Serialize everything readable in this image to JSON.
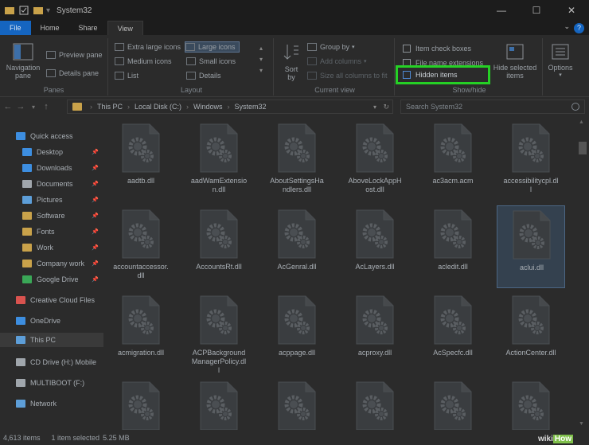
{
  "window": {
    "title": "System32"
  },
  "tabs": [
    "File",
    "Home",
    "Share",
    "View"
  ],
  "ribbon": {
    "panes": {
      "navigation_pane": "Navigation pane",
      "preview_pane": "Preview pane",
      "details_pane": "Details pane",
      "label": "Panes"
    },
    "layout": {
      "options": [
        "Extra large icons",
        "Large icons",
        "Medium icons",
        "Small icons",
        "List",
        "Details"
      ],
      "selected": "Large icons",
      "label": "Layout"
    },
    "current_view": {
      "sort_by": "Sort by",
      "group_by": "Group by",
      "add_columns": "Add columns",
      "size_columns": "Size all columns to fit",
      "label": "Current view"
    },
    "show_hide": {
      "item_check_boxes": "Item check boxes",
      "file_name_extensions": "File name extensions",
      "hidden_items": "Hidden items",
      "hide_selected": "Hide selected items",
      "label": "Show/hide"
    },
    "options": "Options"
  },
  "address": {
    "crumbs": [
      "This PC",
      "Local Disk (C:)",
      "Windows",
      "System32"
    ],
    "search_placeholder": "Search System32"
  },
  "nav": [
    {
      "label": "Quick access",
      "icon": "star-icon",
      "pinned": false
    },
    {
      "label": "Desktop",
      "icon": "desktop-icon",
      "pinned": true
    },
    {
      "label": "Downloads",
      "icon": "download-icon",
      "pinned": true
    },
    {
      "label": "Documents",
      "icon": "document-icon",
      "pinned": true
    },
    {
      "label": "Pictures",
      "icon": "picture-icon",
      "pinned": true
    },
    {
      "label": "Software",
      "icon": "folder-icon",
      "pinned": true
    },
    {
      "label": "Fonts",
      "icon": "folder-icon",
      "pinned": true
    },
    {
      "label": "Work",
      "icon": "folder-icon",
      "pinned": true
    },
    {
      "label": "Company work",
      "icon": "folder-icon",
      "pinned": true
    },
    {
      "label": "Google Drive",
      "icon": "google-drive-icon",
      "pinned": true
    },
    {
      "label": "Creative Cloud Files",
      "icon": "creative-cloud-icon",
      "pinned": false
    },
    {
      "label": "OneDrive",
      "icon": "cloud-icon",
      "pinned": false
    },
    {
      "label": "This PC",
      "icon": "computer-icon",
      "pinned": false
    },
    {
      "label": "CD Drive (H:) Mobile",
      "icon": "cd-drive-icon",
      "pinned": false
    },
    {
      "label": "MULTIBOOT (F:)",
      "icon": "usb-drive-icon",
      "pinned": false
    },
    {
      "label": "Network",
      "icon": "network-icon",
      "pinned": false
    }
  ],
  "files": [
    [
      "aadtb.dll"
    ],
    [
      "aadWamExtension.dll"
    ],
    [
      "AboutSettingsHandlers.dll"
    ],
    [
      "AboveLockAppHost.dll"
    ],
    [
      "ac3acm.acm"
    ],
    [
      "accessibilitycpl.dll"
    ],
    [
      "accountaccessor.dll"
    ],
    [
      "AccountsRt.dll"
    ],
    [
      "AcGenral.dll"
    ],
    [
      "AcLayers.dll"
    ],
    [
      "acledit.dll"
    ],
    [
      "aclui.dll"
    ],
    [
      "acmigration.dll"
    ],
    [
      "ACPBackgroundManagerPolicy.dll"
    ],
    [
      "acppage.dll"
    ],
    [
      "acproxy.dll"
    ],
    [
      "AcSpecfc.dll"
    ],
    [
      "ActionCenter.dll"
    ]
  ],
  "file_labels": [
    [
      "aadtb.dll"
    ],
    [
      "aadWamExtensio",
      "n.dll"
    ],
    [
      "AboutSettingsHa",
      "ndlers.dll"
    ],
    [
      "AboveLockAppH",
      "ost.dll"
    ],
    [
      "ac3acm.acm"
    ],
    [
      "accessibilitycpl.dl",
      "l"
    ],
    [
      "accountaccessor.",
      "dll"
    ],
    [
      "AccountsRt.dll"
    ],
    [
      "AcGenral.dll"
    ],
    [
      "AcLayers.dll"
    ],
    [
      "acledit.dll"
    ],
    [
      "aclui.dll"
    ],
    [
      "acmigration.dll"
    ],
    [
      "ACPBackground",
      "ManagerPolicy.dl",
      "l"
    ],
    [
      "acppage.dll"
    ],
    [
      "acproxy.dll"
    ],
    [
      "AcSpecfc.dll"
    ],
    [
      "ActionCenter.dll"
    ]
  ],
  "selected_file": "aclui.dll",
  "status": {
    "count": "4,613 items",
    "selection": "1 item selected",
    "size": "5.25 MB"
  },
  "watermark": "wikiHow",
  "colors": {
    "highlight": "#25d025",
    "file_tab": "#1565c0",
    "folder": "#c9a24a"
  }
}
